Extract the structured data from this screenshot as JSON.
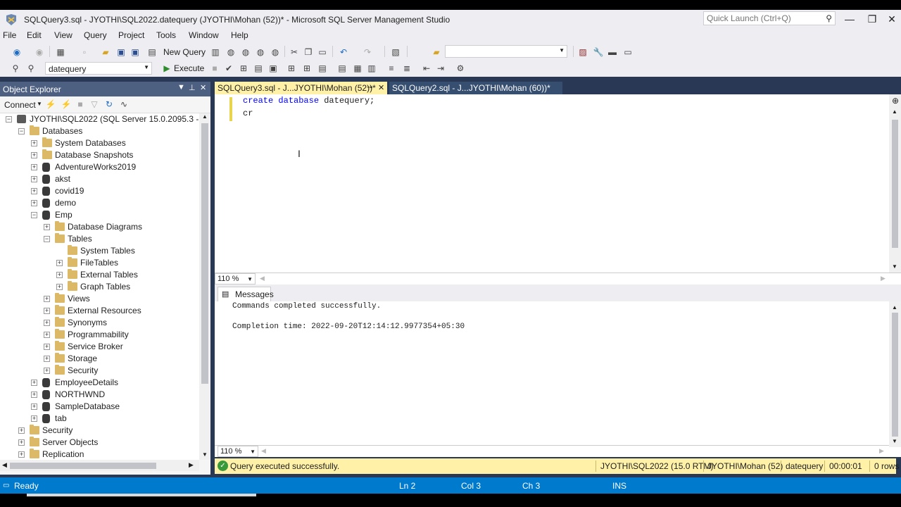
{
  "window": {
    "title": "SQLQuery3.sql - JYOTHI\\SQL2022.datequery (JYOTHI\\Mohan (52))* - Microsoft SQL Server Management Studio",
    "quick_launch_placeholder": "Quick Launch (Ctrl+Q)",
    "minimize": "—",
    "restore": "❐",
    "close": "✕"
  },
  "menu": [
    "File",
    "Edit",
    "View",
    "Query",
    "Project",
    "Tools",
    "Window",
    "Help"
  ],
  "toolbar": {
    "new_query": "New Query",
    "execute": "Execute",
    "database_select": "datequery"
  },
  "object_explorer": {
    "title": "Object Explorer",
    "connect": "Connect",
    "server": "JYOTHI\\SQL2022 (SQL Server 15.0.2095.3 - JYOT",
    "tree": [
      {
        "label": "Databases",
        "level": 1,
        "expander": "−",
        "icon": "folder"
      },
      {
        "label": "System Databases",
        "level": 2,
        "expander": "+",
        "icon": "folder"
      },
      {
        "label": "Database Snapshots",
        "level": 2,
        "expander": "+",
        "icon": "folder"
      },
      {
        "label": "AdventureWorks2019",
        "level": 2,
        "expander": "+",
        "icon": "db"
      },
      {
        "label": "akst",
        "level": 2,
        "expander": "+",
        "icon": "db"
      },
      {
        "label": "covid19",
        "level": 2,
        "expander": "+",
        "icon": "db"
      },
      {
        "label": "demo",
        "level": 2,
        "expander": "+",
        "icon": "db"
      },
      {
        "label": "Emp",
        "level": 2,
        "expander": "−",
        "icon": "db"
      },
      {
        "label": "Database Diagrams",
        "level": 3,
        "expander": "+",
        "icon": "folder"
      },
      {
        "label": "Tables",
        "level": 3,
        "expander": "−",
        "icon": "folder"
      },
      {
        "label": "System Tables",
        "level": 4,
        "expander": "",
        "icon": "folder"
      },
      {
        "label": "FileTables",
        "level": 4,
        "expander": "+",
        "icon": "folder"
      },
      {
        "label": "External Tables",
        "level": 4,
        "expander": "+",
        "icon": "folder"
      },
      {
        "label": "Graph Tables",
        "level": 4,
        "expander": "+",
        "icon": "folder"
      },
      {
        "label": "Views",
        "level": 3,
        "expander": "+",
        "icon": "folder"
      },
      {
        "label": "External Resources",
        "level": 3,
        "expander": "+",
        "icon": "folder"
      },
      {
        "label": "Synonyms",
        "level": 3,
        "expander": "+",
        "icon": "folder"
      },
      {
        "label": "Programmability",
        "level": 3,
        "expander": "+",
        "icon": "folder"
      },
      {
        "label": "Service Broker",
        "level": 3,
        "expander": "+",
        "icon": "folder"
      },
      {
        "label": "Storage",
        "level": 3,
        "expander": "+",
        "icon": "folder"
      },
      {
        "label": "Security",
        "level": 3,
        "expander": "+",
        "icon": "folder"
      },
      {
        "label": "EmployeeDetails",
        "level": 2,
        "expander": "+",
        "icon": "db"
      },
      {
        "label": "NORTHWND",
        "level": 2,
        "expander": "+",
        "icon": "db"
      },
      {
        "label": "SampleDatabase",
        "level": 2,
        "expander": "+",
        "icon": "db"
      },
      {
        "label": "tab",
        "level": 2,
        "expander": "+",
        "icon": "db"
      },
      {
        "label": "Security",
        "level": 1,
        "expander": "+",
        "icon": "folder"
      },
      {
        "label": "Server Objects",
        "level": 1,
        "expander": "+",
        "icon": "folder"
      },
      {
        "label": "Replication",
        "level": 1,
        "expander": "+",
        "icon": "folder"
      }
    ]
  },
  "tabs": {
    "active": "SQLQuery3.sql - J...JYOTHI\\Mohan (52))*",
    "inactive": "SQLQuery2.sql - J...JYOTHI\\Mohan (60))*"
  },
  "editor": {
    "line1_kw1": "create",
    "line1_kw2": "database",
    "line1_rest": " datequery;",
    "line2": "cr",
    "zoom": "110 %"
  },
  "results": {
    "tab": "Messages",
    "line1": "Commands completed successfully.",
    "line2": "Completion time: 2022-09-20T12:14:12.9977354+05:30",
    "zoom": "110 %"
  },
  "query_status": {
    "message": "Query executed successfully.",
    "server": "JYOTHI\\SQL2022 (15.0 RTM)",
    "user": "JYOTHI\\Mohan (52)",
    "database": "datequery",
    "elapsed": "00:00:01",
    "rows": "0 rows"
  },
  "statusbar": {
    "ready": "Ready",
    "ln": "Ln 2",
    "col": "Col 3",
    "ch": "Ch 3",
    "ins": "INS"
  },
  "colors": {
    "frame": "#293955",
    "accent_tab": "#fff1a8",
    "statusbar": "#007acc"
  }
}
